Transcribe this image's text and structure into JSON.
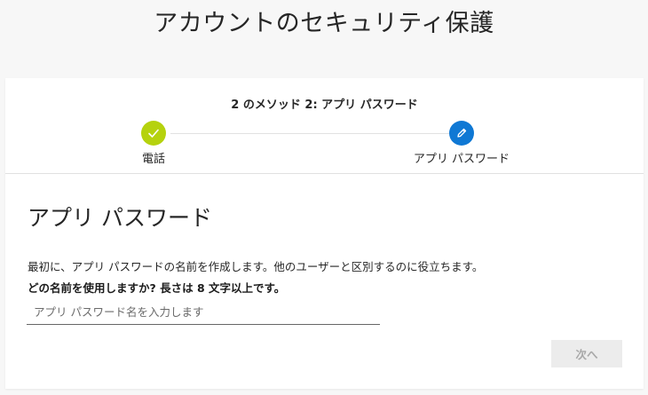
{
  "page": {
    "title": "アカウントのセキュリティ保護"
  },
  "progress": {
    "caption": "2 のメソッド 2: アプリ パスワード",
    "steps": [
      {
        "label": "電話",
        "state": "completed",
        "icon": "check-icon"
      },
      {
        "label": "アプリ パスワード",
        "state": "current",
        "icon": "pencil-icon"
      }
    ],
    "colors": {
      "completed": "#b5d20e",
      "current": "#0f78d4"
    }
  },
  "form": {
    "heading": "アプリ パスワード",
    "description": "最初に、アプリ パスワードの名前を作成します。他のユーザーと区別するのに役立ちます。",
    "question": "どの名前を使用しますか? 長さは 8 文字以上です。",
    "name_input": {
      "placeholder": "アプリ パスワード名を入力します",
      "value": ""
    },
    "next_button": {
      "label": "次へ",
      "state": "disabled"
    }
  }
}
